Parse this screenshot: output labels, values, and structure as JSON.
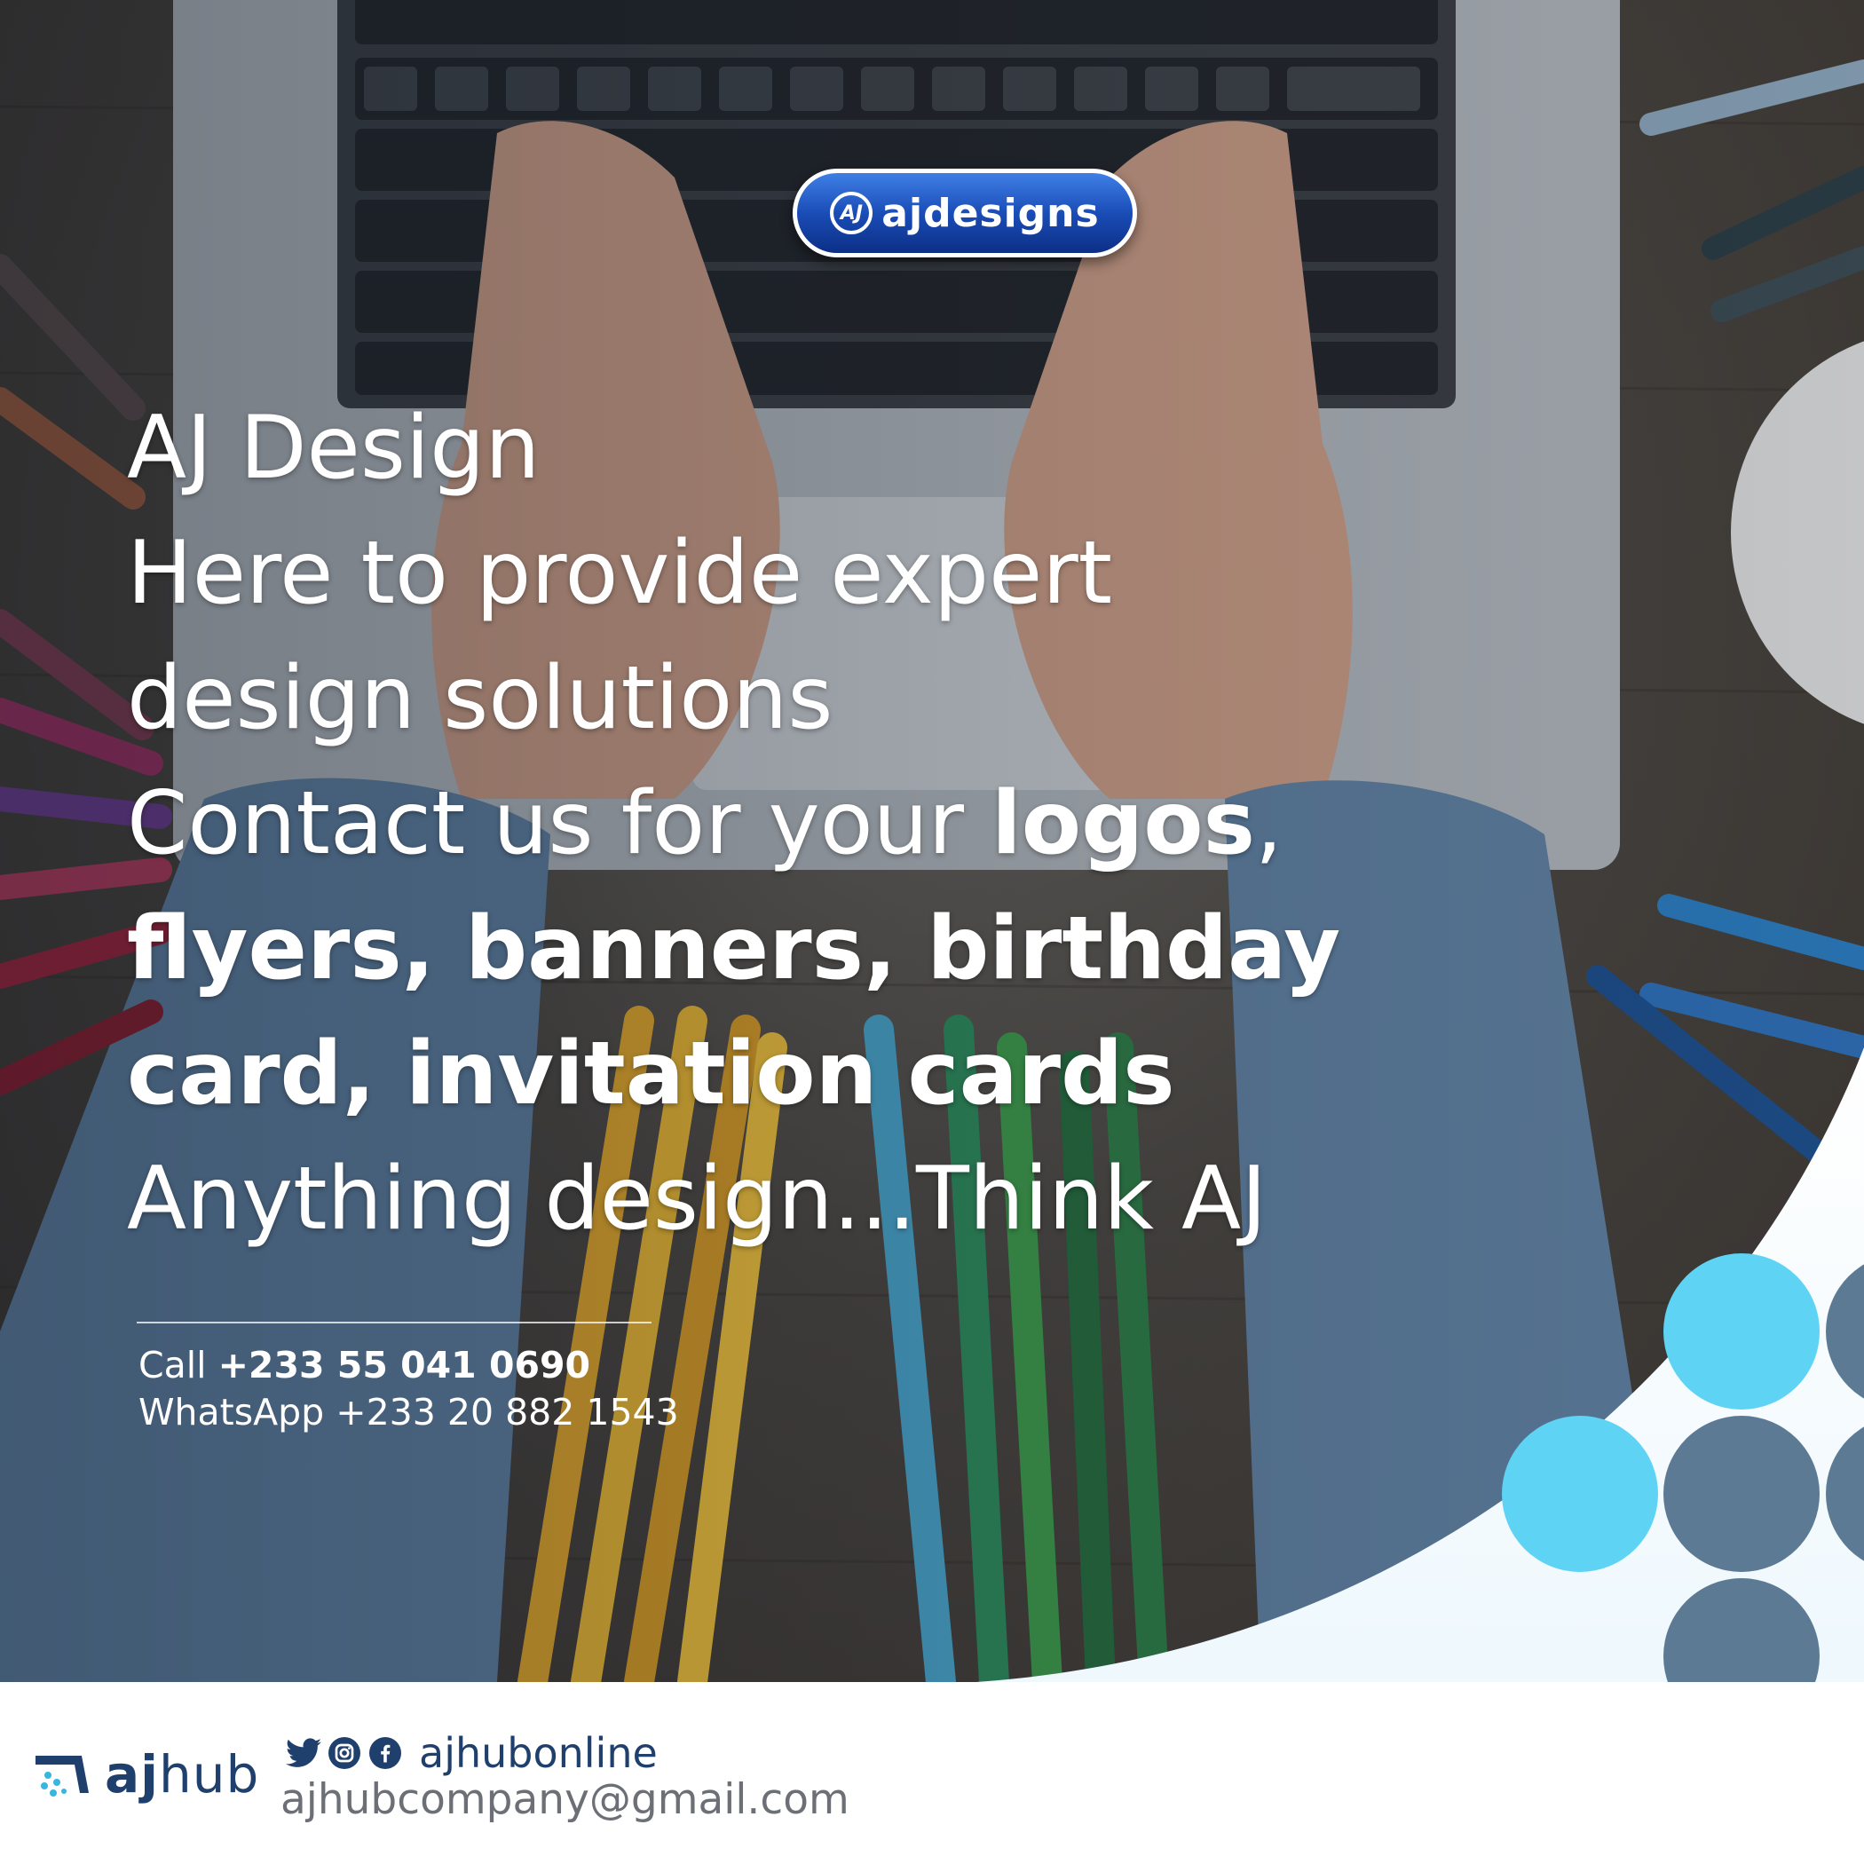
{
  "logo": {
    "mark": "AJ",
    "wordmark": "ajdesigns"
  },
  "headline": {
    "line1": "AJ Design",
    "line2": "Here to provide expert",
    "line3": "design solutions",
    "line4_prefix": "Contact us for your ",
    "line4_bold": "logos",
    "line4_suffix": ",",
    "line5_bold": "flyers, banners, birthday",
    "line6_bold": "card, invitation cards",
    "line7": "Anything design...Think AJ"
  },
  "contact": {
    "call_label": "Call ",
    "call_number": "+233 55 041 0690",
    "whatsapp_label": "WhatsApp ",
    "whatsapp_number": "+233 20 882 1543"
  },
  "footer": {
    "brand_bold": "aj",
    "brand_light": "hub",
    "social_icons": [
      "twitter-icon",
      "instagram-icon",
      "facebook-icon"
    ],
    "handle": "ajhubonline",
    "email": "ajhubcompany@gmail.com"
  },
  "colors": {
    "logo_blue": "#1a4db7",
    "dot_cyan": "#5ed3f3",
    "dot_slate": "#5c7a93",
    "brand_navy": "#1f3f6d",
    "email_gray": "#6c6f75"
  }
}
